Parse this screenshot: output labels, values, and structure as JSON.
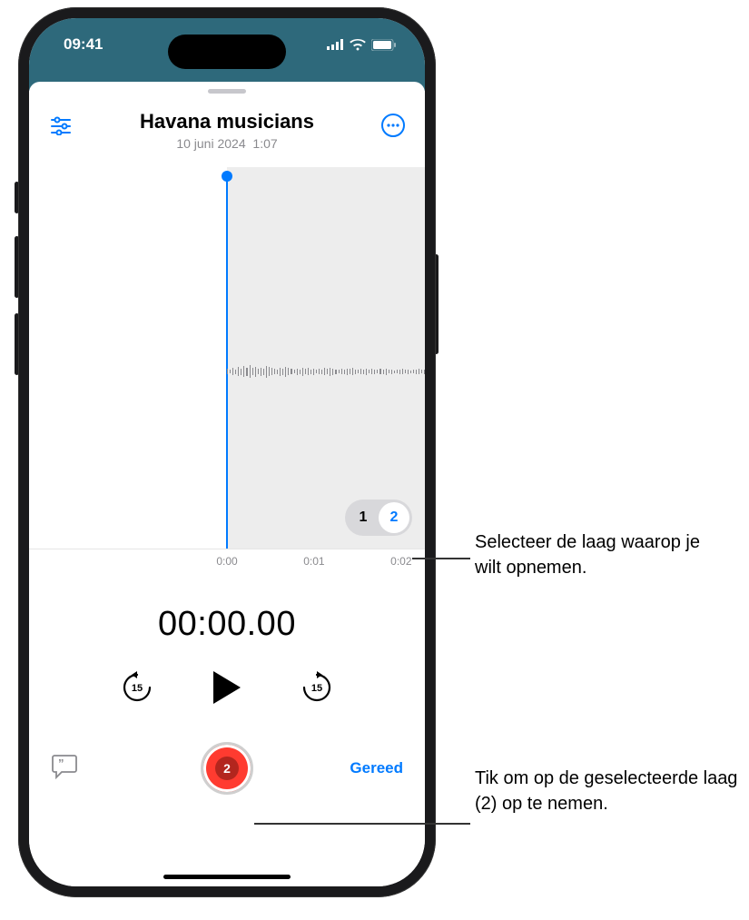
{
  "status": {
    "time": "09:41"
  },
  "header": {
    "title": "Havana musicians",
    "date": "10 juni 2024",
    "duration": "1:07"
  },
  "layers": {
    "one": "1",
    "two": "2"
  },
  "ruler": {
    "t0": "0:00",
    "t1": "0:01",
    "t2": "0:02"
  },
  "timer": "00:00.00",
  "skip_amount": "15",
  "record_layer_badge": "2",
  "done_label": "Gereed",
  "callouts": {
    "layer_select": "Selecteer de laag waarop je wilt opnemen.",
    "record": "Tik om op de geselecteerde laag (2) op te nemen."
  }
}
